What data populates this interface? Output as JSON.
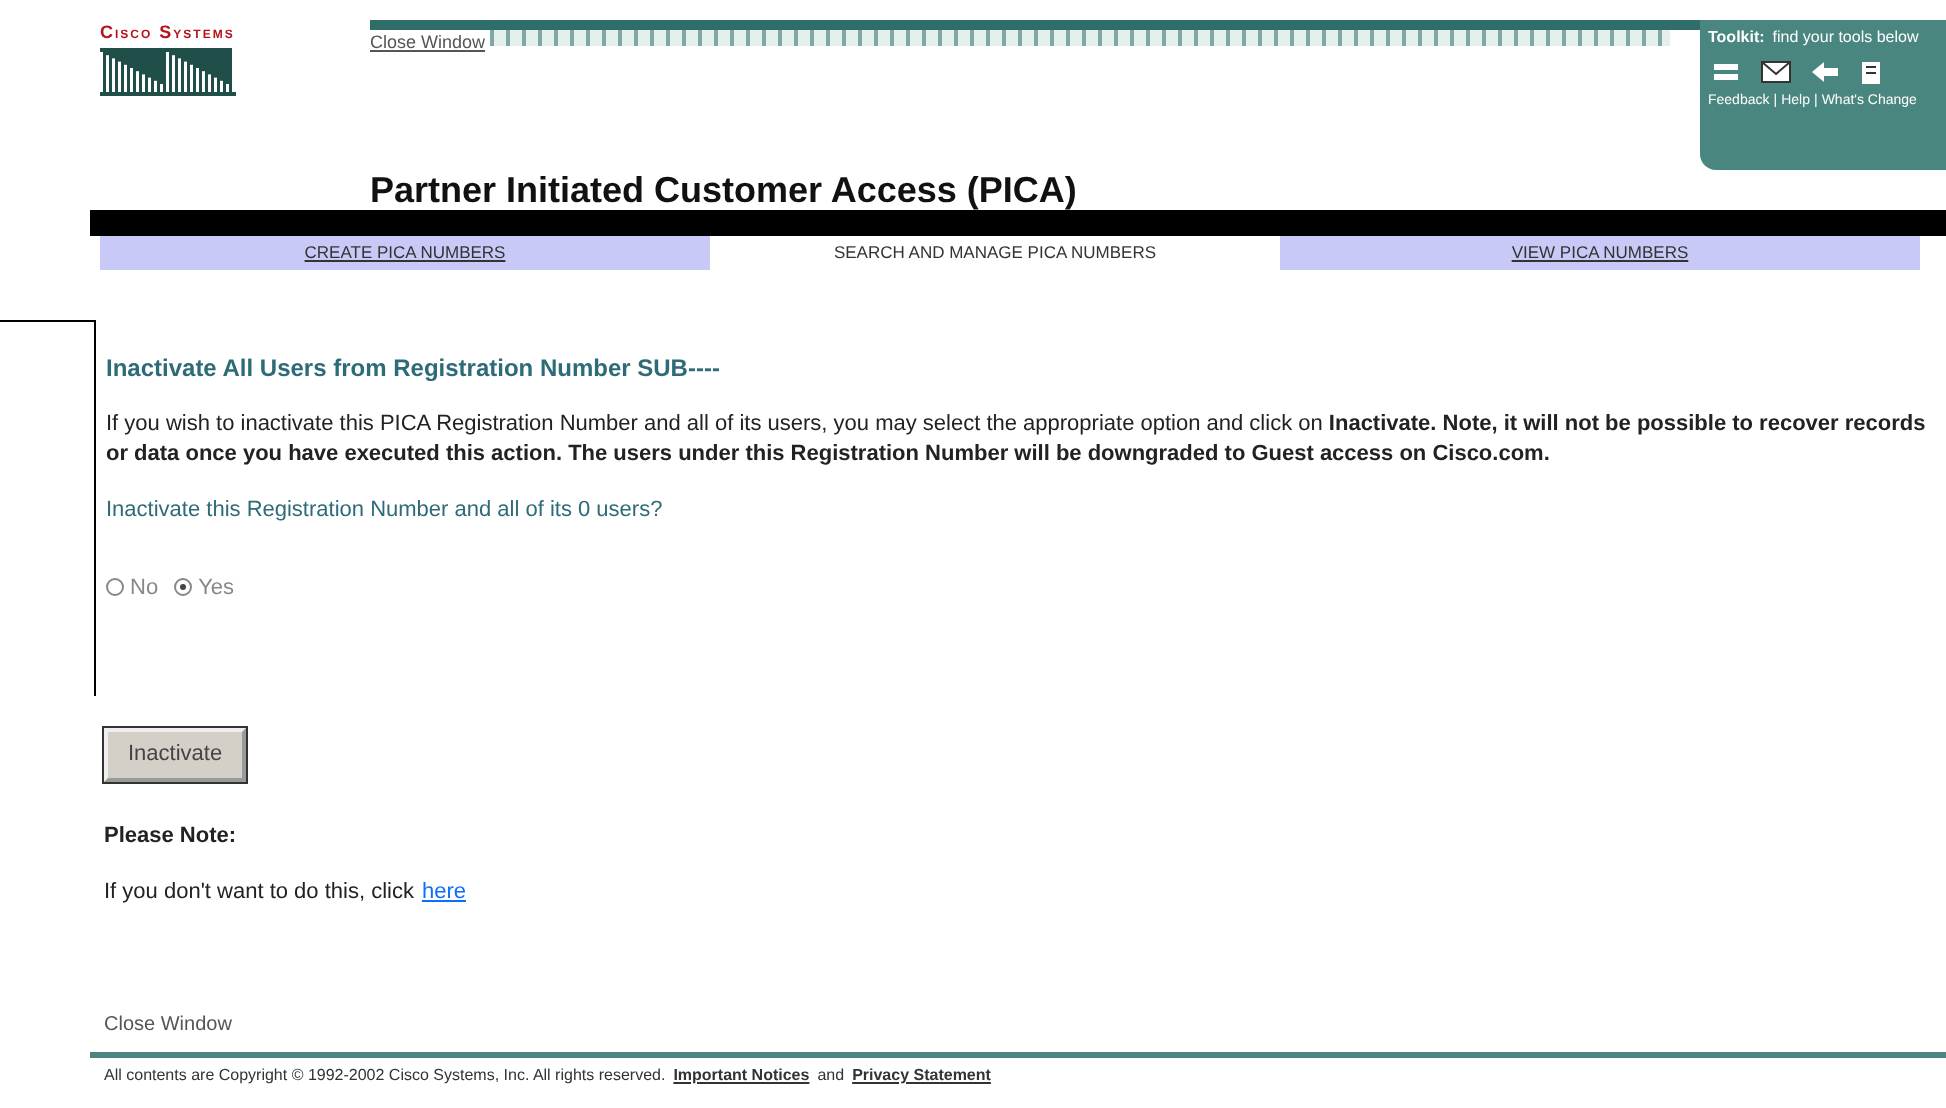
{
  "logo": {
    "text": "Cisco Systems"
  },
  "header": {
    "close_link": "Close Window",
    "toolkit_title": "Toolkit:",
    "toolkit_hint": "find your tools below",
    "toolkit_links": [
      {
        "label": "Feedback"
      },
      {
        "label": "Help"
      },
      {
        "label": "What's Change"
      }
    ],
    "separator": "|"
  },
  "page_title": "Partner Initiated Customer Access (PICA)",
  "tabs": [
    {
      "label": "CREATE PICA NUMBERS",
      "selected": false
    },
    {
      "label": "SEARCH AND MANAGE PICA NUMBERS",
      "selected": true
    },
    {
      "label": "VIEW PICA NUMBERS",
      "selected": false
    }
  ],
  "heading": "Inactivate All Users from Registration Number SUB----",
  "intro": "If you wish to inactivate this PICA Registration Number and all of its users, you may select the appropriate option and click on **Inactivate. Note, it will not be possible to recover records or data once you have executed this action. The users under this Registration Number will be downgraded to Guest access on Cisco.com.**",
  "question": "Inactivate this Registration Number and all of its 0 users?",
  "options": [
    {
      "label": "No",
      "selected": false
    },
    {
      "label": "Yes",
      "selected": true
    }
  ],
  "button": "Inactivate",
  "note_title": "Please Note:",
  "note_text": "If you don't want to do this, click",
  "note_link": "here",
  "footer_close": "Close Window",
  "copyright": "All contents are Copyright © 1992-2002 Cisco Systems, Inc. All rights reserved.",
  "footer_links": [
    {
      "label": "Important Notices"
    },
    {
      "label": "and",
      "kind": "text"
    },
    {
      "label": "Privacy Statement"
    }
  ]
}
